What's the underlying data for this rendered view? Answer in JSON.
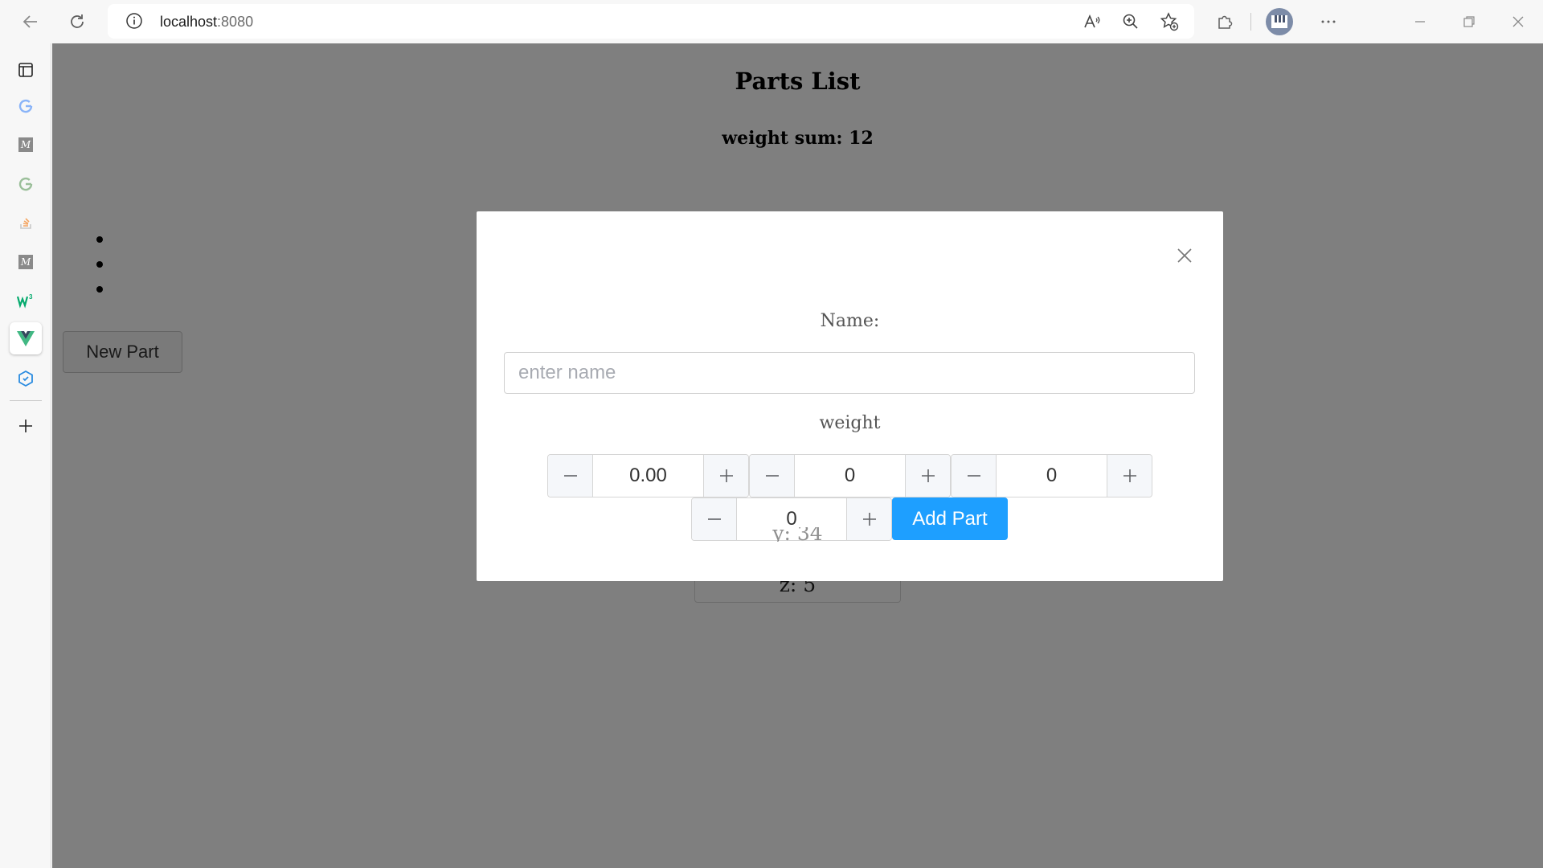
{
  "browser": {
    "url_host": "localhost",
    "url_port": ":8080"
  },
  "sidebar": {
    "items": [
      {
        "name": "tab-actions-icon"
      },
      {
        "name": "google-icon"
      },
      {
        "name": "m-site-icon"
      },
      {
        "name": "google-icon"
      },
      {
        "name": "stackoverflow-icon"
      },
      {
        "name": "m-site-icon"
      },
      {
        "name": "w3schools-icon"
      },
      {
        "name": "vue-icon"
      },
      {
        "name": "extension-cube-icon"
      },
      {
        "name": "add-icon"
      }
    ]
  },
  "page": {
    "title": "Parts List",
    "weight_sum": "weight sum: 12",
    "new_part_label": "New Part",
    "card": {
      "y_line": "y: 34",
      "z_line": "z: 5"
    }
  },
  "modal": {
    "name_label": "Name:",
    "name_placeholder": "enter name",
    "name_value": "",
    "weight_label": "weight",
    "steppers": [
      {
        "value": "0.00"
      },
      {
        "value": "0"
      },
      {
        "value": "0"
      },
      {
        "value": "0"
      }
    ],
    "add_part_label": "Add Part"
  },
  "colors": {
    "primary_button": "#1e9fff",
    "overlay": "rgba(0,0,0,0.5)"
  }
}
